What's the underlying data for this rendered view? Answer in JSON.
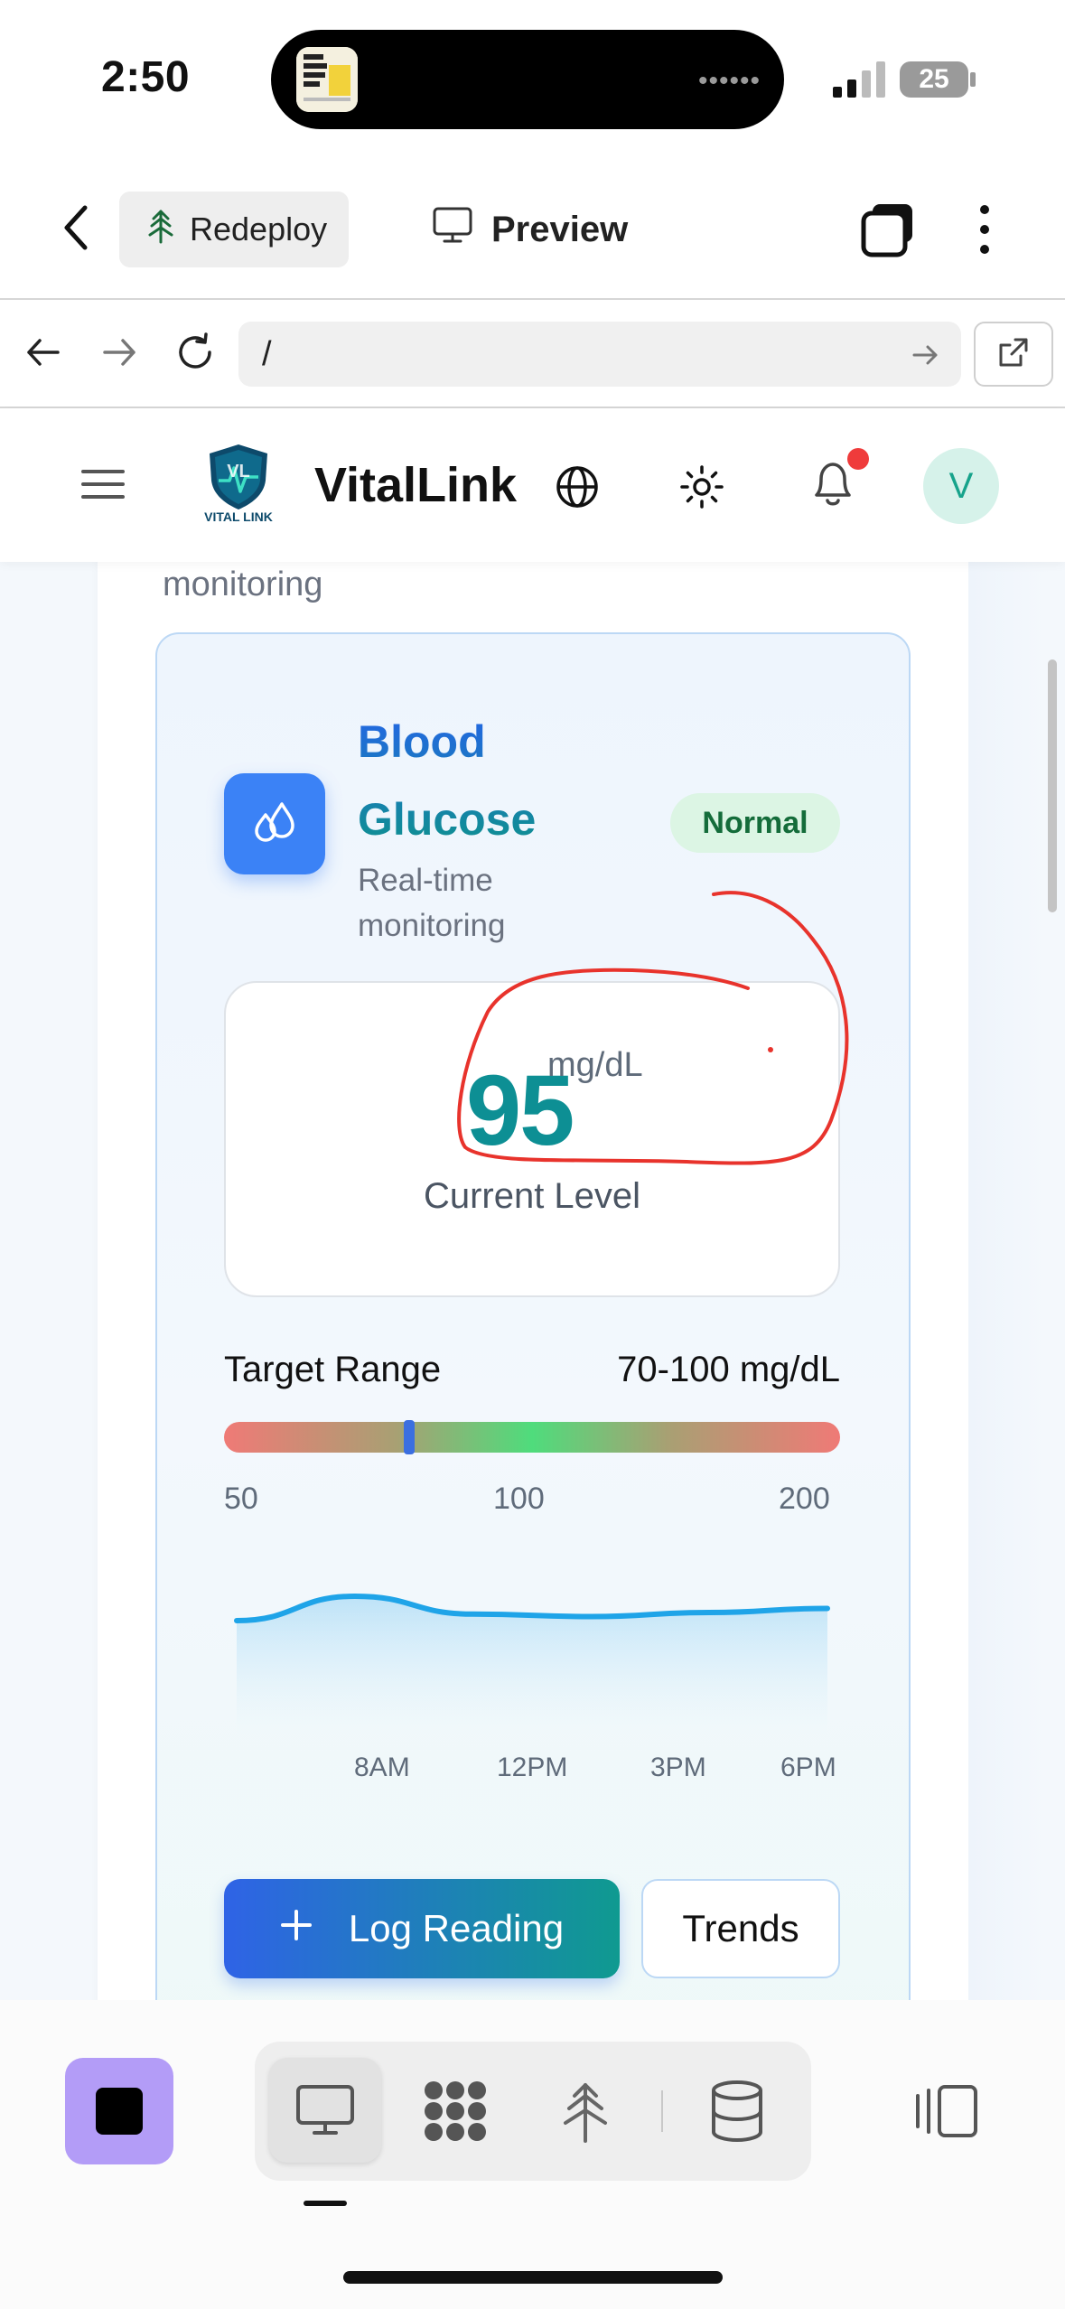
{
  "status_bar": {
    "time": "2:50",
    "battery": "25"
  },
  "editor_bar": {
    "redeploy_label": "Redeploy",
    "preview_label": "Preview"
  },
  "browser": {
    "url": "/"
  },
  "app_header": {
    "brand": "VitalLink",
    "logo_text": "VITAL LINK",
    "avatar_initial": "V"
  },
  "outer_card": {
    "description_tail": "monitoring"
  },
  "glucose_card": {
    "title": "Blood Glucose",
    "subtitle": "Real-time monitoring",
    "status_badge": "Normal",
    "current_value": "95",
    "unit": "mg/dL",
    "current_label": "Current Level",
    "target_range_label": "Target Range",
    "target_range_value": "70-100 mg/dL",
    "scale_ticks": [
      "50",
      "100",
      "200"
    ],
    "marker_fraction": 0.3,
    "trend": {
      "times": [
        "8AM",
        "12PM",
        "3PM",
        "6PM"
      ],
      "values": [
        40,
        70,
        48,
        45,
        50,
        55
      ]
    },
    "log_button": "Log Reading",
    "trends_button": "Trends"
  },
  "colors": {
    "brand_blue": "#3b82f6",
    "teal": "#0d8f94",
    "normal_badge_bg": "#dcf5e4",
    "annotation_red": "#e8332c",
    "stop_button": "#b39cf7"
  },
  "icons": {
    "back": "chevron-left-icon",
    "redeploy": "tree-icon",
    "preview": "monitor-icon",
    "windows": "windows-icon",
    "more": "kebab-icon",
    "language": "globe-icon",
    "theme": "sun-icon",
    "notifications": "bell-icon",
    "glucose": "droplets-icon"
  }
}
